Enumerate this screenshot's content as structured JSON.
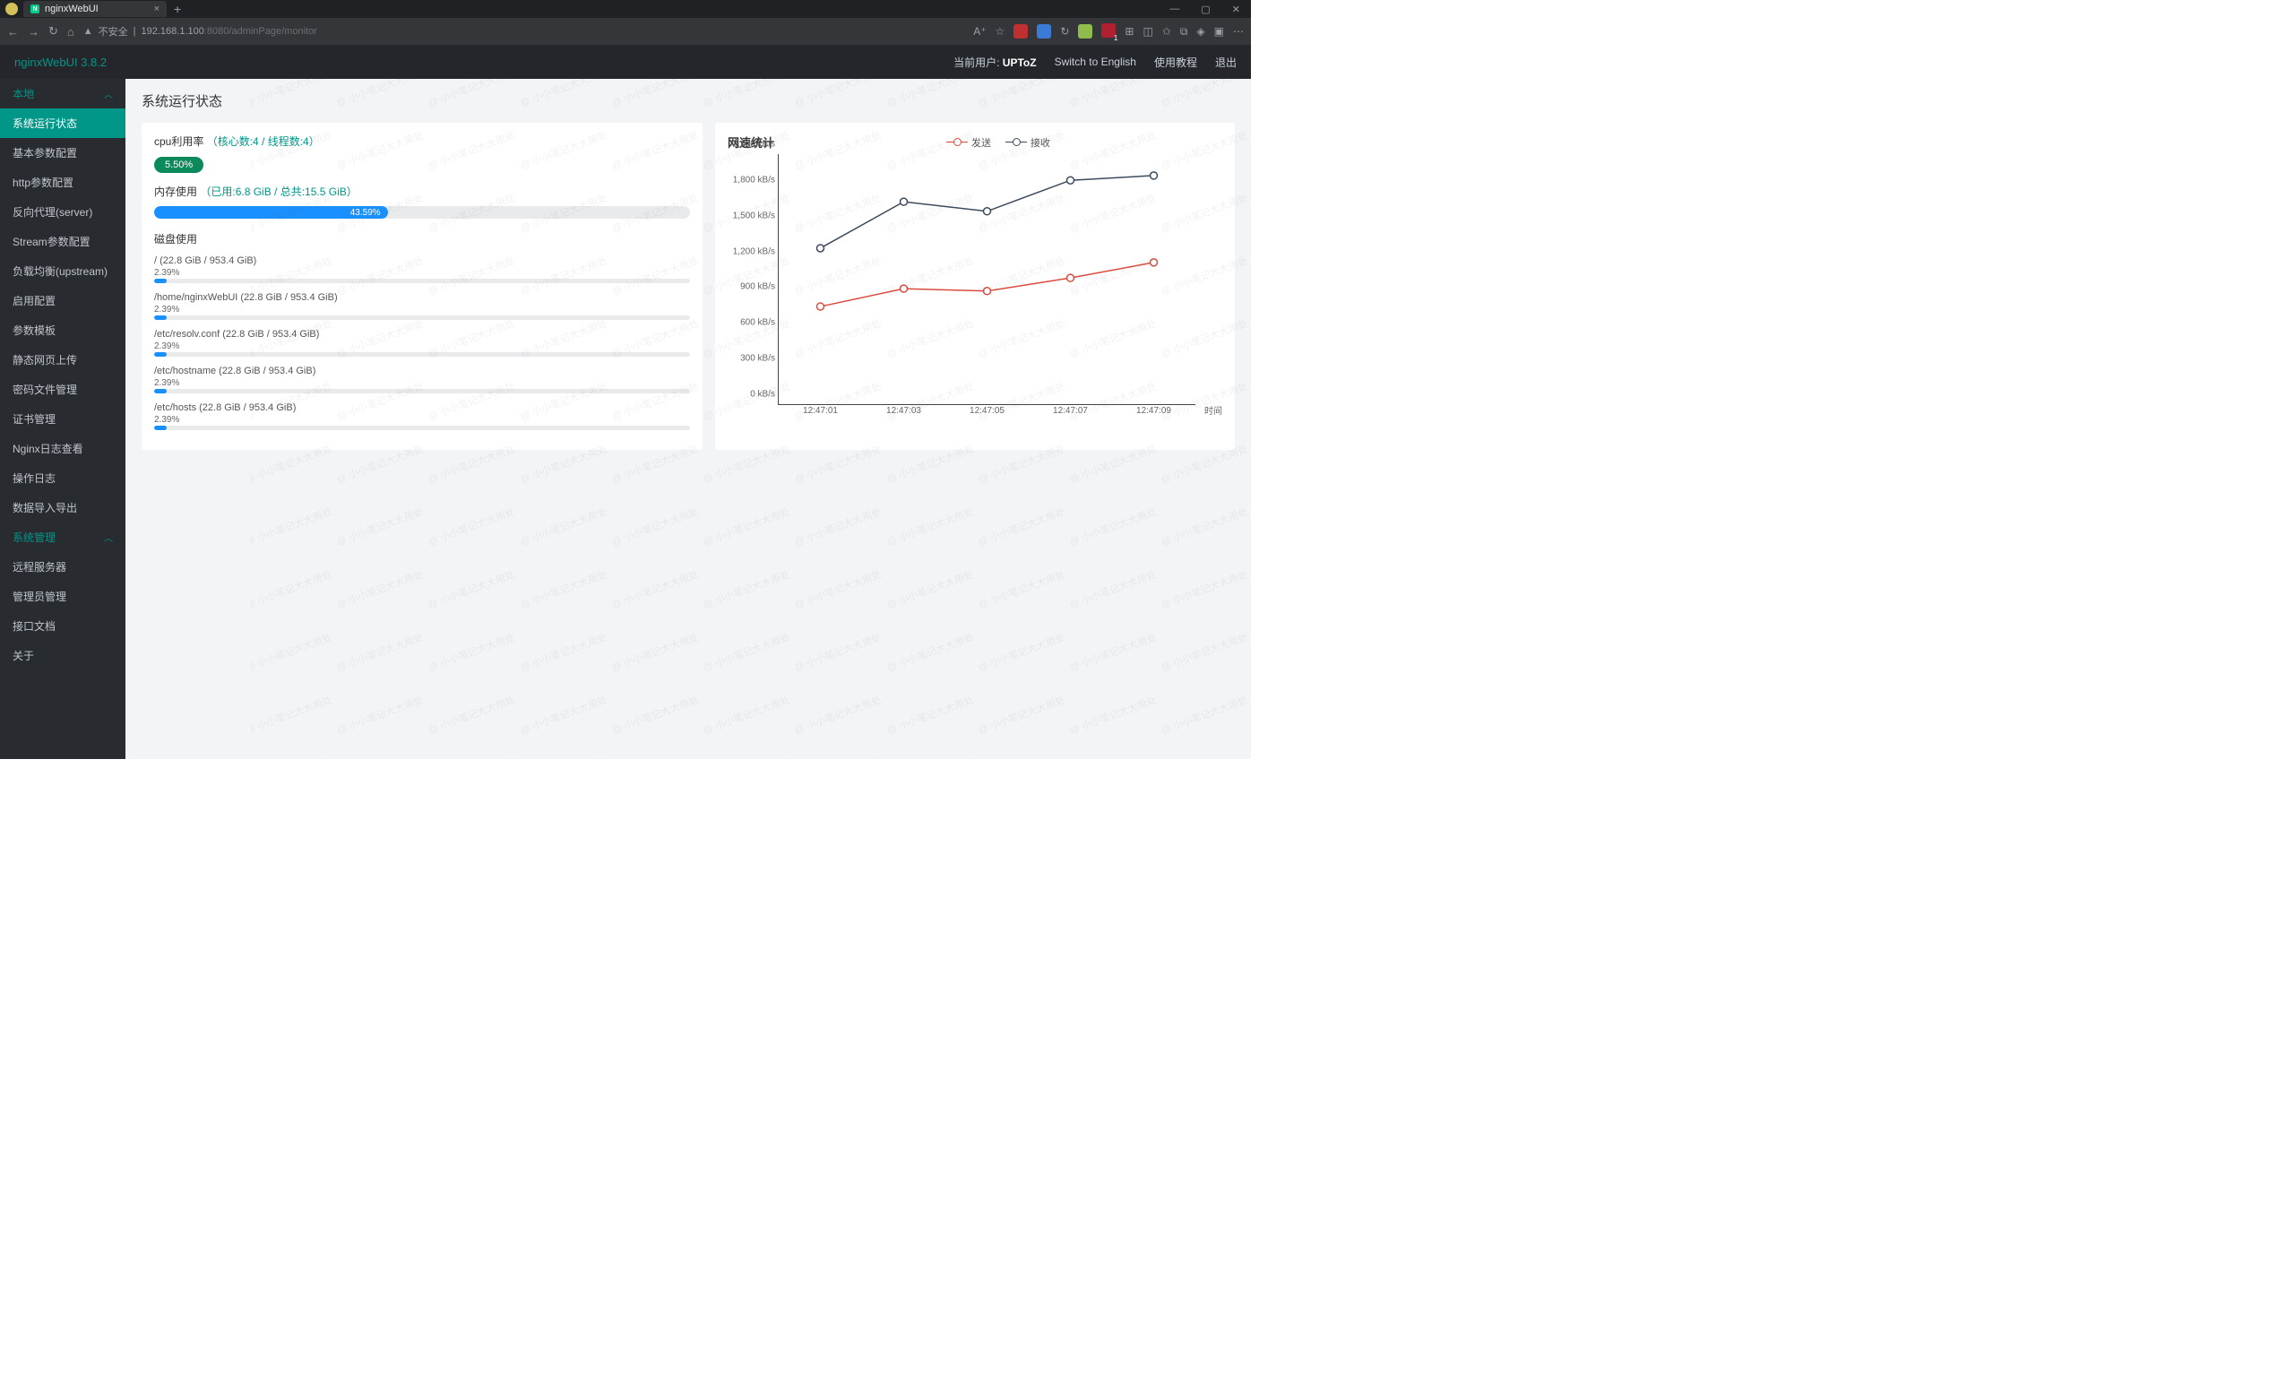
{
  "browser": {
    "tab_title": "nginxWebUI",
    "tab_favicon_letter": "N",
    "new_tab": "+",
    "close_x": "×",
    "url_insecure": "不安全",
    "url_sep": "|",
    "url_host": "192.168.1.100",
    "url_port": ":8080",
    "url_path": "/adminPage/monitor",
    "window_min": "—",
    "window_max": "▢",
    "window_close": "✕",
    "nav_back": "←",
    "nav_fwd": "→",
    "nav_reload": "↻",
    "nav_home": "⌂",
    "icon_ai": "A⁺",
    "icon_star": "☆",
    "ext_red": "#c03030",
    "ext_blue": "#3a7bd5",
    "ext_reload": "↻",
    "ext_green": "#8fbc4a",
    "ext_badge_bg": "#b02030",
    "ext_badge_num": "1",
    "ext_grid": "⊞",
    "ext_side": "◫",
    "ext_fav": "✩",
    "ext_collect": "⧉",
    "ext_wallet": "◈",
    "ext_tab": "▣",
    "ext_more": "⋯"
  },
  "header": {
    "logo": "nginxWebUI 3.8.2",
    "current_user_label": "当前用户:",
    "current_user": "UPToZ",
    "switch_lang": "Switch to English",
    "tutorial": "使用教程",
    "logout": "退出"
  },
  "sidebar": {
    "group_local": "本地",
    "items_local": [
      "系统运行状态",
      "基本参数配置",
      "http参数配置",
      "反向代理(server)",
      "Stream参数配置",
      "负载均衡(upstream)",
      "启用配置",
      "参数模板",
      "静态网页上传",
      "密码文件管理",
      "证书管理",
      "Nginx日志查看",
      "操作日志",
      "数据导入导出"
    ],
    "active_index": 0,
    "group_system": "系统管理",
    "items_system": [
      "远程服务器",
      "管理员管理",
      "接口文档",
      "关于"
    ]
  },
  "page": {
    "title": "系统运行状态",
    "cpu_label": "cpu利用率",
    "cpu_detail": "（核心数:4 / 线程数:4）",
    "cpu_value": "5.50%",
    "mem_label": "内存使用",
    "mem_detail": "（已用:6.8 GiB / 总共:15.5 GiB）",
    "mem_pct": "43.59%",
    "mem_pct_num": 43.59,
    "disk_label": "磁盘使用",
    "disks": [
      {
        "name": "/ (22.8 GiB / 953.4 GiB)",
        "pct": "2.39%",
        "pct_num": 2.39
      },
      {
        "name": "/home/nginxWebUI (22.8 GiB / 953.4 GiB)",
        "pct": "2.39%",
        "pct_num": 2.39
      },
      {
        "name": "/etc/resolv.conf (22.8 GiB / 953.4 GiB)",
        "pct": "2.39%",
        "pct_num": 2.39
      },
      {
        "name": "/etc/hostname (22.8 GiB / 953.4 GiB)",
        "pct": "2.39%",
        "pct_num": 2.39
      },
      {
        "name": "/etc/hosts (22.8 GiB / 953.4 GiB)",
        "pct": "2.39%",
        "pct_num": 2.39
      }
    ]
  },
  "watermark": "@ 小小笔记大大用处",
  "chart_data": {
    "type": "line",
    "title": "网速统计",
    "xlabel": "时间",
    "ylabel": "",
    "ylim": [
      0,
      2100
    ],
    "y_ticks": [
      "0 kB/s",
      "300 kB/s",
      "600 kB/s",
      "900 kB/s",
      "1,200 kB/s",
      "1,500 kB/s",
      "1,800 kB/s",
      "2,100 kB/s"
    ],
    "y_tick_vals": [
      0,
      300,
      600,
      900,
      1200,
      1500,
      1800,
      2100
    ],
    "categories": [
      "12:47:01",
      "12:47:03",
      "12:47:05",
      "12:47:07",
      "12:47:09"
    ],
    "series": [
      {
        "name": "发送",
        "color": "#d94b3e",
        "values": [
          820,
          970,
          950,
          1060,
          1190
        ]
      },
      {
        "name": "接收",
        "color": "#3b4a5c",
        "values": [
          1310,
          1700,
          1620,
          1880,
          1920
        ]
      }
    ]
  }
}
